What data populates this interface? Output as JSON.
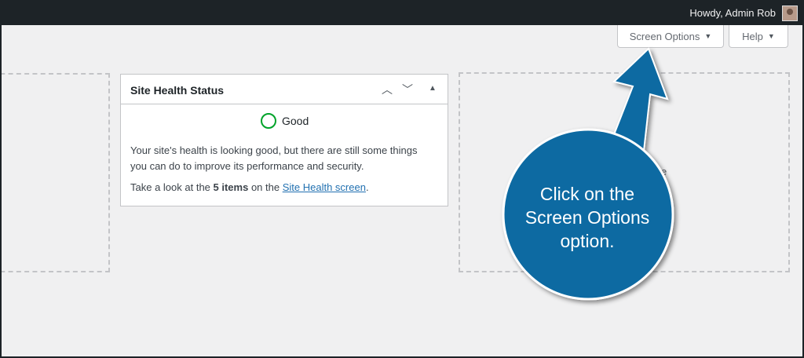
{
  "admin_bar": {
    "greeting": "Howdy, Admin Rob"
  },
  "screen_meta": {
    "screen_options_label": "Screen Options",
    "help_label": "Help"
  },
  "widget": {
    "title": "Site Health Status",
    "status": "Good",
    "description": "Your site's health is looking good, but there are still some things you can do to improve its performance and security.",
    "items_text_prefix": "Take a look at the ",
    "items_count_text": "5 items",
    "items_text_middle": " on the ",
    "link_text": "Site Health screen",
    "items_text_suffix": "."
  },
  "partial_text": "e",
  "callout": {
    "text": "Click on the Screen Options option.",
    "color": "#0b6aa2"
  },
  "colors": {
    "admin_bar": "#1d2327",
    "status_good": "#00a32a",
    "link": "#2271b1"
  }
}
